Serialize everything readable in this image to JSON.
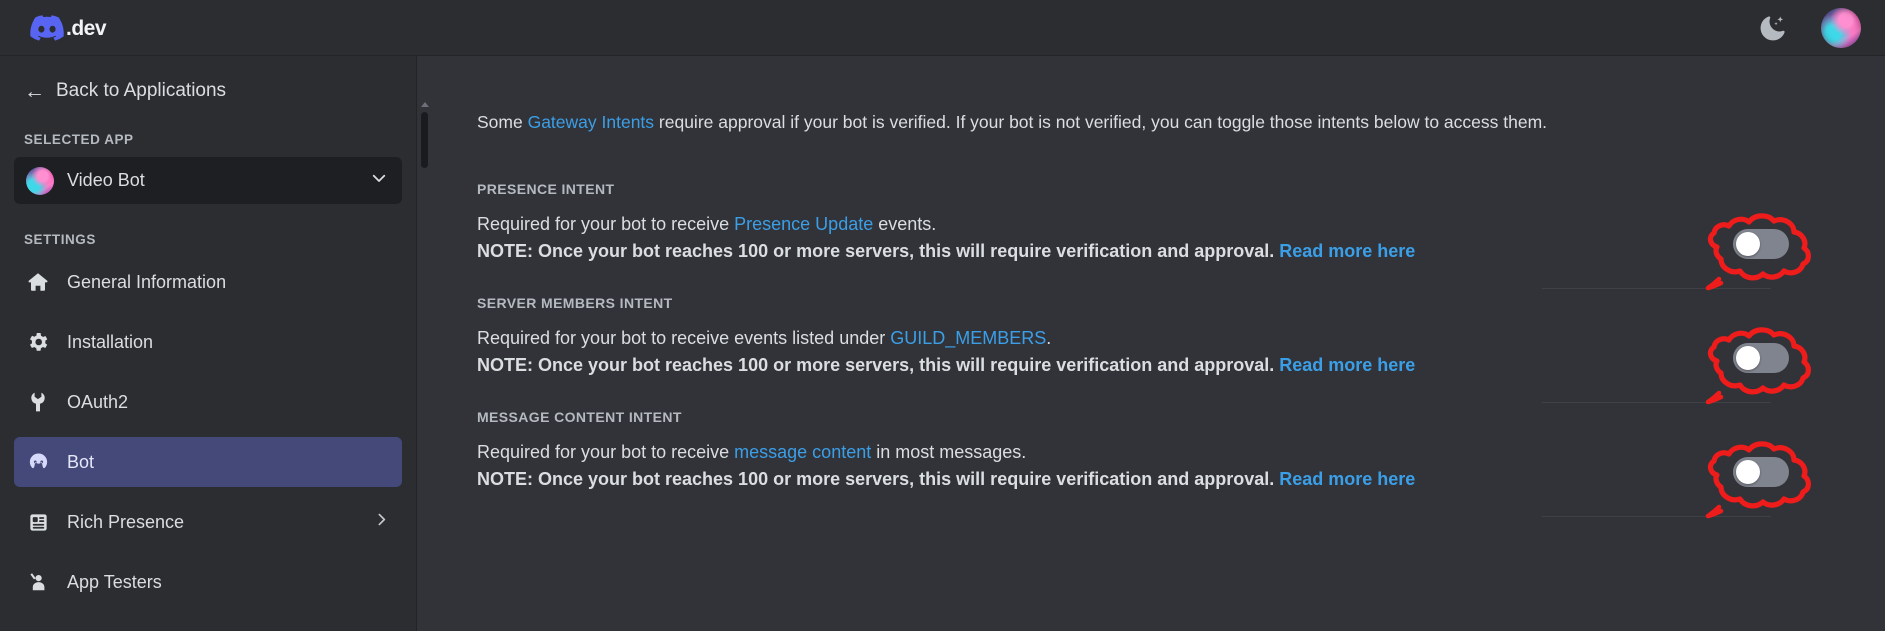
{
  "header": {
    "brand_logo_icon": "discord-logo-icon",
    "brand_suffix": ".dev",
    "theme_toggle_icon": "moon-icon",
    "avatar_icon": "user-avatar"
  },
  "sidebar": {
    "back_arrow_icon": "arrow-left-icon",
    "back_label": "Back to Applications",
    "selected_app_heading": "SELECTED APP",
    "selected_app": {
      "name": "Video Bot",
      "avatar_icon": "app-avatar-icon",
      "chevron_icon": "chevron-down-icon"
    },
    "settings_heading": "SETTINGS",
    "items": [
      {
        "label": "General Information",
        "icon": "home-icon",
        "active": false,
        "chevron": false
      },
      {
        "label": "Installation",
        "icon": "gear-icon",
        "active": false,
        "chevron": false
      },
      {
        "label": "OAuth2",
        "icon": "wrench-icon",
        "active": false,
        "chevron": false
      },
      {
        "label": "Bot",
        "icon": "bot-icon",
        "active": true,
        "chevron": false
      },
      {
        "label": "Rich Presence",
        "icon": "card-list-icon",
        "active": false,
        "chevron": true
      },
      {
        "label": "App Testers",
        "icon": "person-raise-hand-icon",
        "active": false,
        "chevron": false
      }
    ]
  },
  "main": {
    "intro": {
      "before": "Some ",
      "link": "Gateway Intents",
      "after": " require approval if your bot is verified. If your bot is not verified, you can toggle those intents below to access them."
    },
    "note_prefix": "NOTE: Once your bot reaches 100 or more servers, this will require verification and approval. ",
    "note_link": "Read more here",
    "intents": [
      {
        "title": "PRESENCE INTENT",
        "desc_before": "Required for your bot to receive ",
        "desc_link": "Presence Update",
        "desc_after": " events.",
        "toggle_state": "off"
      },
      {
        "title": "SERVER MEMBERS INTENT",
        "desc_before": "Required for your bot to receive events listed under ",
        "desc_link": "GUILD_MEMBERS",
        "desc_after": ".",
        "toggle_state": "off"
      },
      {
        "title": "MESSAGE CONTENT INTENT",
        "desc_before": "Required for your bot to receive ",
        "desc_link": "message content",
        "desc_after": " in most messages.",
        "toggle_state": "off"
      }
    ]
  },
  "colors": {
    "page_bg": "#313338",
    "sidebar_bg": "#2b2d31",
    "active_nav": "#45497a",
    "link_blue": "#3b9fe8",
    "brand_blurple": "#5865f2",
    "annotation_red": "#ef1c1c",
    "toggle_off": "#80848e"
  },
  "annotations": {
    "shape": "hand-drawn-red-cloud-circle",
    "count": 3,
    "targets": [
      "presence-intent-toggle",
      "server-members-intent-toggle",
      "message-content-intent-toggle"
    ]
  }
}
